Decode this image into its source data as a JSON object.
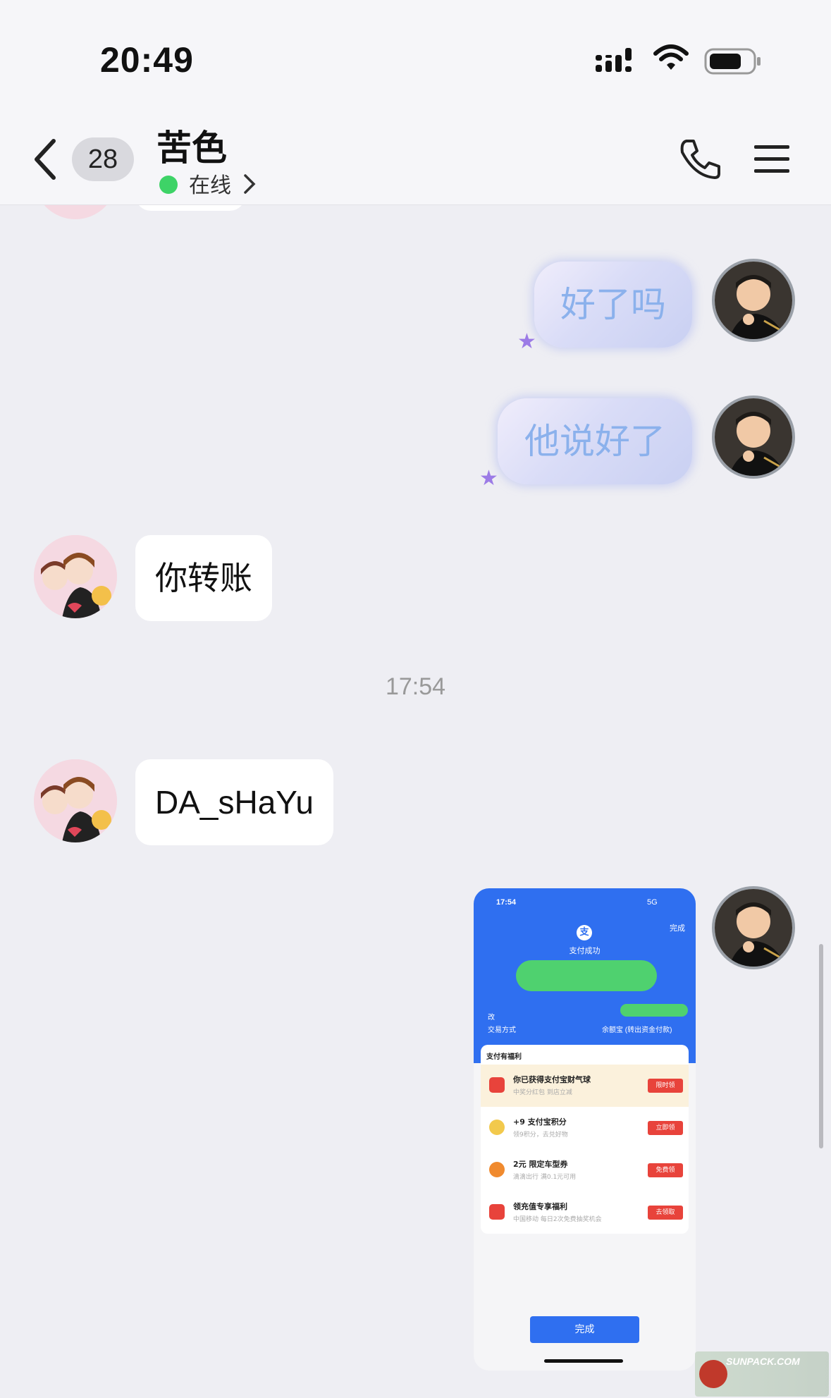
{
  "status_bar": {
    "time": "20:49"
  },
  "header": {
    "unread_count": "28",
    "contact_name": "苦色",
    "status_text": "在线"
  },
  "messages": {
    "m1": "好了吗",
    "m2": "他说好了",
    "m3": "你转账",
    "timestamp": "17:54",
    "m4": "DA_sHaYu"
  },
  "screenshot": {
    "time": "17:54",
    "network": "5G",
    "done_top": "完成",
    "pay_success": "支付成功",
    "change": "改",
    "method_label": "交易方式",
    "method_value": "余额宝 (转出资金付款)",
    "section_title": "支付有福利",
    "rows": [
      {
        "title": "你已获得支付宝财气球",
        "sub": "中奖分红包 到店立减",
        "button": "限时领"
      },
      {
        "title": "+9 支付宝积分",
        "sub": "领9积分，去兑好物",
        "button": "立即领"
      },
      {
        "title": "2元 限定车型券",
        "sub": "滴滴出行 满0.1元可用",
        "button": "免费领"
      },
      {
        "title": "领充值专享福利",
        "sub": "中国移动 每日2次免费抽奖机会",
        "button": "去领取"
      }
    ],
    "done_bottom": "完成"
  },
  "watermark": {
    "text": "SUNPACK.COM"
  },
  "colors": {
    "accent_blue": "#2f6ff0",
    "online_green": "#3ed367",
    "self_text": "#8bb1ec",
    "button_red": "#e8433b"
  }
}
